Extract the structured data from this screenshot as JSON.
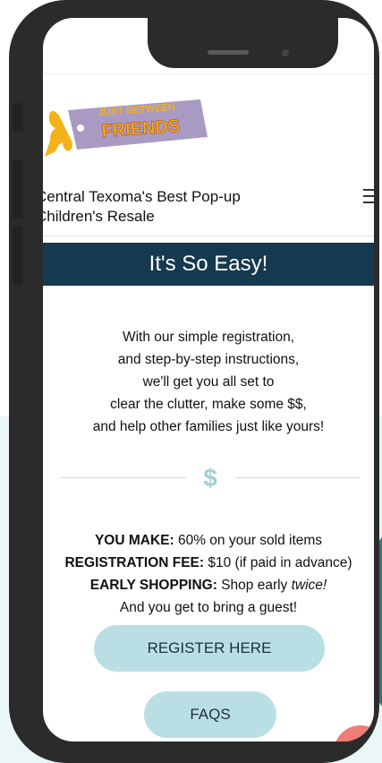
{
  "header": {
    "logo_text_line1": "JUST BETWEEN",
    "logo_text_line2": "FRIENDS",
    "tagline_line1": "Central Texoma's Best Pop-up",
    "tagline_line2": "Children's Resale"
  },
  "banner": {
    "title": "It's So Easy!"
  },
  "intro": {
    "lines": [
      "With our simple registration,",
      "and step-by-step instructions,",
      "we'll get you all set to",
      "clear the clutter, make some $$,",
      "and help other families just like yours!"
    ]
  },
  "divider": {
    "symbol": "$"
  },
  "details": {
    "make_label": "YOU MAKE:",
    "make_value": " 60% on your sold items",
    "fee_label": "REGISTRATION FEE:",
    "fee_value": " $10 (if paid in advance)",
    "early_label": "EARLY SHOPPING:",
    "early_value": " Shop early ",
    "early_emphasis": "twice!",
    "guest": "And you get to bring a guest!"
  },
  "buttons": {
    "register": "REGISTER HERE",
    "faqs": "FAQS"
  },
  "colors": {
    "banner_bg": "#15394f",
    "button_bg": "#b9dfe4",
    "accent_teal": "#2f7675",
    "dollar": "#9fd0d6",
    "chat": "#f07d77"
  }
}
